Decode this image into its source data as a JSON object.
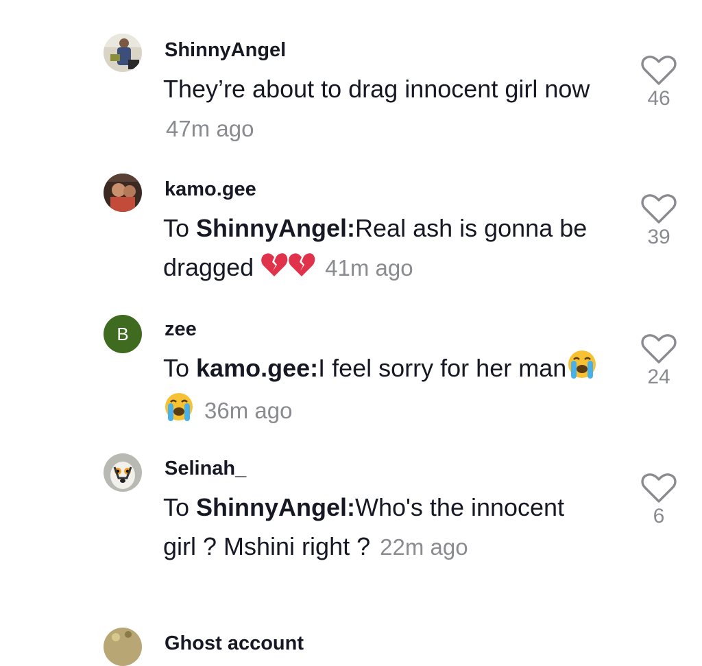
{
  "comments": [
    {
      "username": "ShinnyAngel",
      "reply_prefix": "",
      "reply_to": "",
      "text": "They’re about to drag innocent girl now",
      "time": "47m ago",
      "likes": "46",
      "avatar": "photo"
    },
    {
      "username": "kamo.gee",
      "reply_prefix": "To ",
      "reply_to": "ShinnyAngel:",
      "text": "Real ash is gonna be dragged",
      "emojis": [
        "broken-heart",
        "broken-heart"
      ],
      "time": "41m ago",
      "likes": "39",
      "avatar": "photo"
    },
    {
      "username": "zee",
      "reply_prefix": "To ",
      "reply_to": "kamo.gee:",
      "text": "I feel sorry for her man",
      "emojis": [
        "loudly-crying-face",
        "loudly-crying-face"
      ],
      "time": "36m ago",
      "likes": "24",
      "avatar_letter": "B",
      "avatar_color": "#3e6b20"
    },
    {
      "username": "Selinah_",
      "reply_prefix": "To ",
      "reply_to": "ShinnyAngel:",
      "text": "Who's the innocent girl ? Mshini right ?",
      "time": "22m ago",
      "likes": "6",
      "avatar": "photo"
    },
    {
      "username": "Ghost account",
      "avatar": "photo"
    }
  ],
  "icons": {
    "like": "heart-outline-icon"
  },
  "colors": {
    "text": "#161823",
    "muted": "#8a8b91",
    "avatar_letter_bg": "#3e6b20"
  }
}
